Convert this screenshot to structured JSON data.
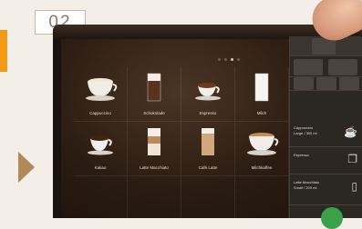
{
  "step": "02",
  "colors": {
    "accent": "#f29a15",
    "arrow": "#b08a5a"
  },
  "tiles": [
    {
      "label": "Cappuccino"
    },
    {
      "label": "Schokolade"
    },
    {
      "label": "Espresso"
    },
    {
      "label": "Milch"
    },
    {
      "label": "Kakao"
    },
    {
      "label": "Latte Macchiato"
    },
    {
      "label": "Café Latte"
    },
    {
      "label": "Milchkaffee"
    }
  ],
  "sidebar": {
    "items": [
      {
        "text": "Cappuccino",
        "sub": "Large / 300 ml"
      },
      {
        "text": "Espresso",
        "sub": ""
      },
      {
        "text": "Latte Macchiato",
        "sub": "Small / 200 ml"
      }
    ]
  }
}
